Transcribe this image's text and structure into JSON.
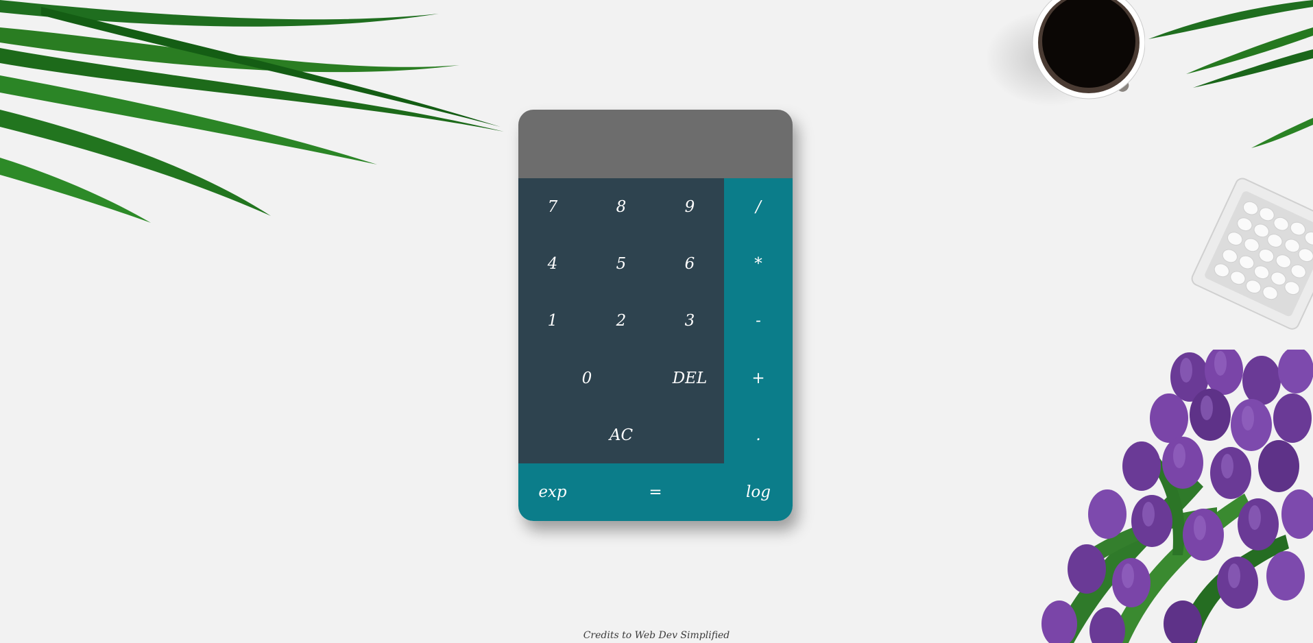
{
  "display": {
    "previous_operand": "",
    "current_operand": ""
  },
  "keys": {
    "seven": "7",
    "eight": "8",
    "nine": "9",
    "divide": "/",
    "four": "4",
    "five": "5",
    "six": "6",
    "multiply": "*",
    "one": "1",
    "two": "2",
    "three": "3",
    "subtract": "-",
    "zero": "0",
    "delete": "DEL",
    "add": "+",
    "all_clear": "AC",
    "decimal": ".",
    "exp": "exp",
    "equals": "=",
    "log": "log"
  },
  "footer": {
    "credits": "Credits to Web Dev Simplified"
  },
  "colors": {
    "background": "#f2f2f2",
    "display": "#6d6d6d",
    "number_pad": "#2e434f",
    "operator_pad": "#0b7d8a",
    "key_text": "#ffffff"
  },
  "decorations": [
    "palm-leaves-top-left",
    "palm-leaves-top-right",
    "coffee-cup",
    "bowl-of-white-candies",
    "purple-tulip-bouquet"
  ]
}
